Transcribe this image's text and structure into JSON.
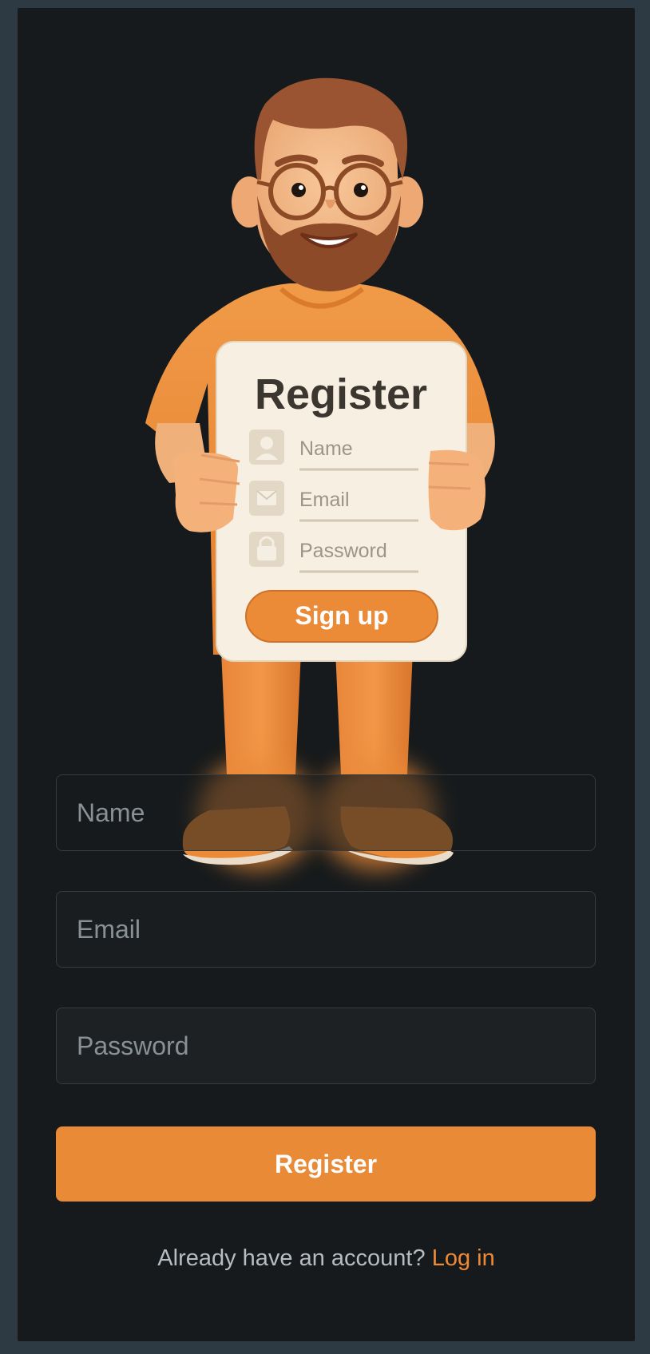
{
  "illustration": {
    "card_title": "Register",
    "card_fields": [
      "Name",
      "Email",
      "Password"
    ],
    "card_button": "Sign up",
    "colors": {
      "shirt": "#ec8c37",
      "card": "#f7efe2",
      "beard": "#8d4a28",
      "skin": "#f1b07a"
    }
  },
  "form": {
    "name_placeholder": "Name",
    "email_placeholder": "Email",
    "password_placeholder": "Password",
    "submit_label": "Register"
  },
  "footer": {
    "prompt": "Already have an account?",
    "link": "Log in"
  },
  "colors": {
    "background": "#161a1c",
    "outer": "#2d3a43",
    "accent": "#e88a36",
    "input_border": "#353b3f",
    "placeholder": "#8a9196"
  }
}
